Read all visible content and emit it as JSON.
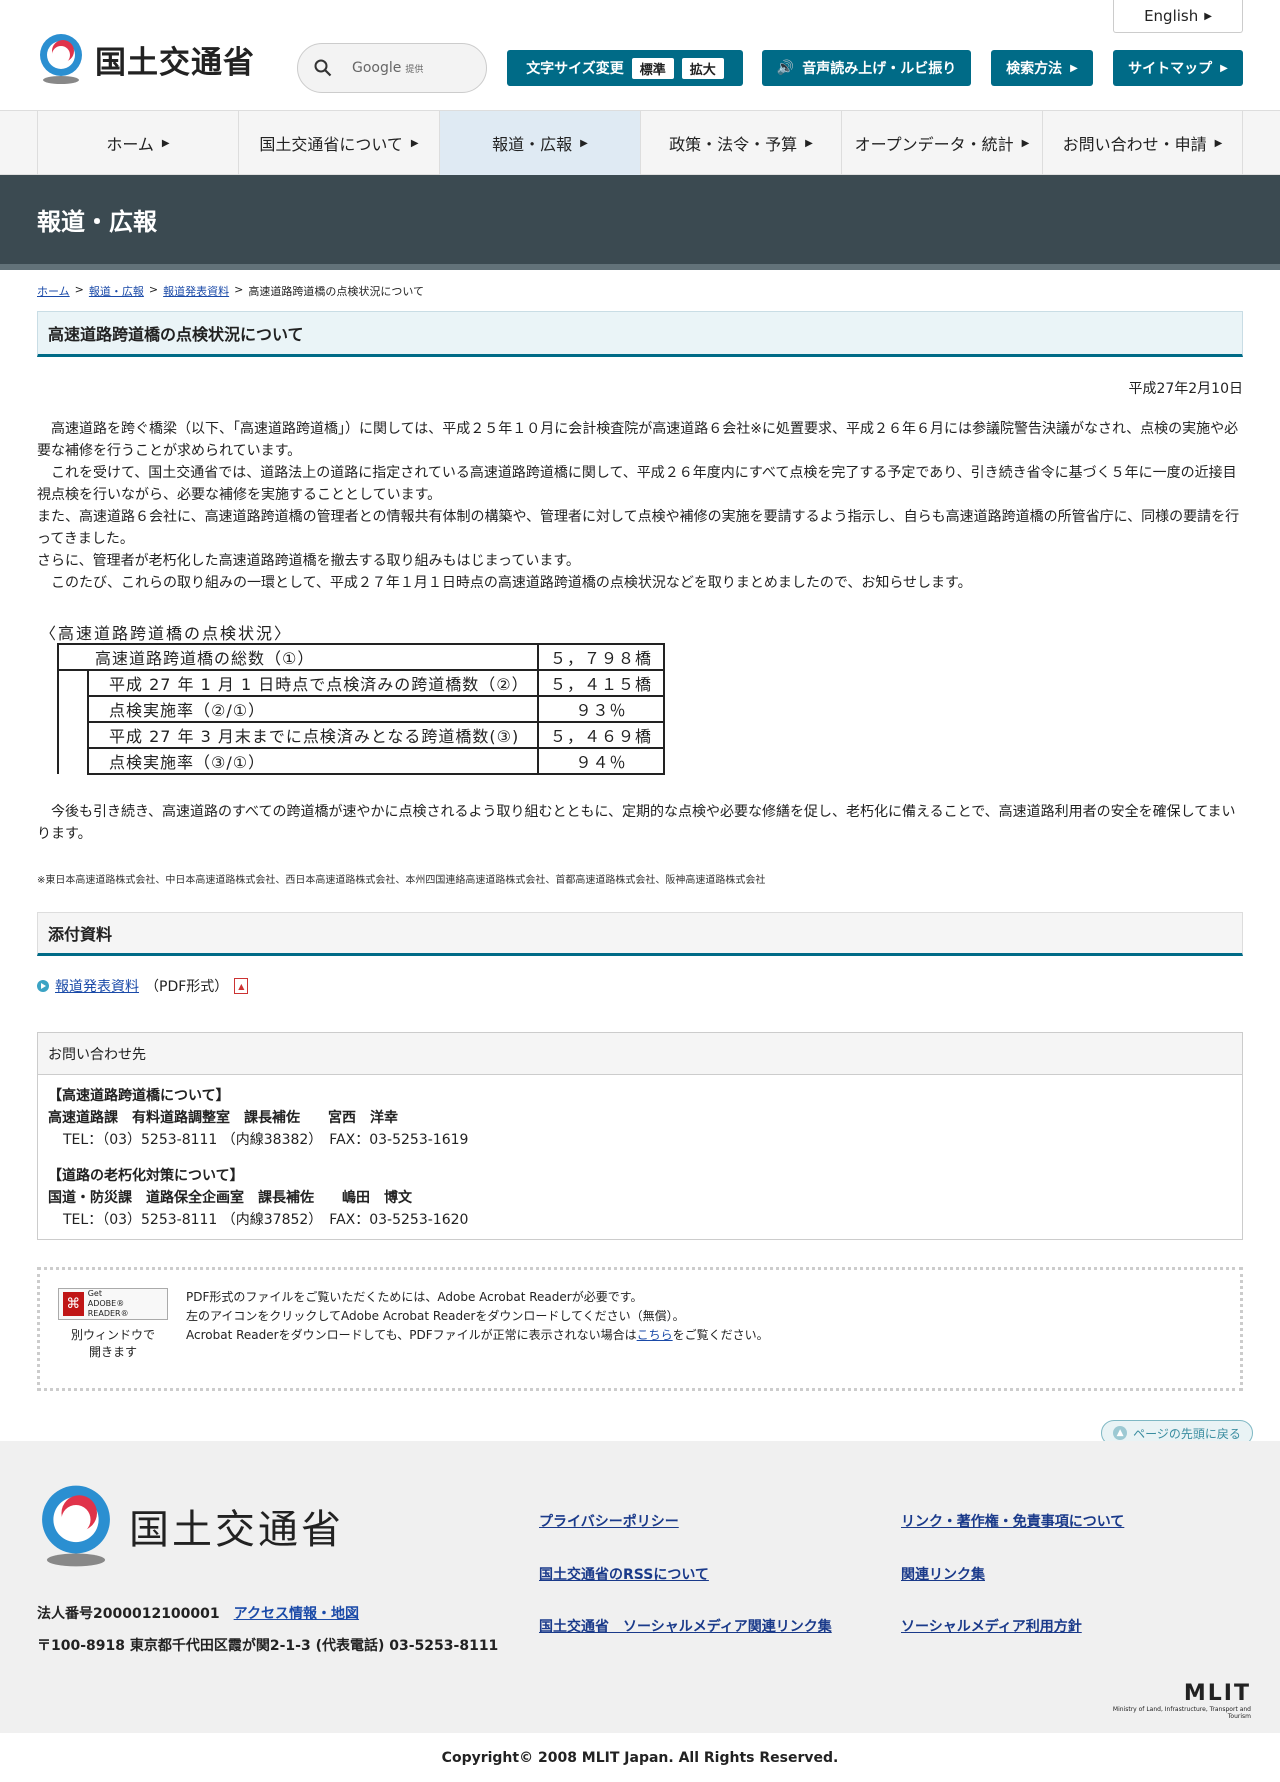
{
  "header": {
    "logo_text": "国土交通省",
    "search_placeholder": "Google",
    "search_suffix": "提供",
    "english": "English",
    "font_size_label": "文字サイズ変更",
    "font_standard": "標準",
    "font_large": "拡大",
    "speech": "音声読み上げ・ルビ振り",
    "search_method": "検索方法",
    "sitemap": "サイトマップ"
  },
  "nav": [
    "ホーム",
    "国土交通省について",
    "報道・広報",
    "政策・法令・予算",
    "オープンデータ・統計",
    "お問い合わせ・申請"
  ],
  "banner_title": "報道・広報",
  "breadcrumb": {
    "home": "ホーム",
    "press": "報道・広報",
    "releases": "報道発表資料",
    "current": "高速道路跨道橋の点検状況について",
    "sep": ">"
  },
  "article": {
    "title": "高速道路跨道橋の点検状況について",
    "date": "平成27年2月10日",
    "paragraphs": [
      "　高速道路を跨ぐ橋梁（以下、「高速道路跨道橋」）に関しては、平成２５年１０月に会計検査院が高速道路６会社※に処置要求、平成２６年６月には参議院警告決議がなされ、点検の実施や必要な補修を行うことが求められています。",
      "　これを受けて、国土交通省では、道路法上の道路に指定されている高速道路跨道橋に関して、平成２６年度内にすべて点検を完了する予定であり、引き続き省令に基づく５年に一度の近接目視点検を行いながら、必要な補修を実施することとしています。",
      "また、高速道路６会社に、高速道路跨道橋の管理者との情報共有体制の構築や、管理者に対して点検や補修の実施を要請するよう指示し、自らも高速道路跨道橋の所管省庁に、同様の要請を行ってきました。",
      "さらに、管理者が老朽化した高速道路跨道橋を撤去する取り組みもはじまっています。",
      "　このたび、これらの取り組みの一環として、平成２７年１月１日時点の高速道路跨道橋の点検状況などを取りまとめましたので、お知らせします。"
    ],
    "table_title": "〈高速道路跨道橋の点検状況〉",
    "table_rows": [
      {
        "label": "高速道路跨道橋の総数（①）",
        "value": "５，７９８橋"
      },
      {
        "label": "平成 27 年 1 月 1 日時点で点検済みの跨道橋数（②）",
        "value": "５，４１５橋"
      },
      {
        "label": "点検実施率（②/①）",
        "value": "９３％"
      },
      {
        "label": "平成 27 年 3 月末までに点検済みとなる跨道橋数(③)",
        "value": "５，４６９橋"
      },
      {
        "label": "点検実施率（③/①）",
        "value": "９４％"
      }
    ],
    "closing": "　今後も引き続き、高速道路のすべての跨道橋が速やかに点検されるよう取り組むとともに、定期的な点検や必要な修繕を促し、老朽化に備えることで、高速道路利用者の安全を確保してまいります。",
    "note": "※東日本高速道路株式会社、中日本高速道路株式会社、西日本高速道路株式会社、本州四国連絡高速道路株式会社、首都高速道路株式会社、阪神高速道路株式会社"
  },
  "attachments": {
    "title": "添付資料",
    "link": "報道発表資料",
    "format": "（PDF形式）"
  },
  "contact": {
    "title": "お問い合わせ先",
    "sections": [
      {
        "heading": "【高速道路跨道橋について】",
        "dept": "高速道路課　有料道路調整室　課長補佐　　宮西　洋幸",
        "tel": "TEL：（03）5253-8111 （内線38382）　FAX：03-5253-1619"
      },
      {
        "heading": "【道路の老朽化対策について】",
        "dept": "国道・防災課　道路保全企画室　課長補佐　　嶋田　博文",
        "tel": "TEL：（03）5253-8111 （内線37852）　FAX：03-5253-1620"
      }
    ]
  },
  "acrobat": {
    "badge_get": "Get",
    "badge_name": "ADOBE® READER®",
    "window_note_1": "別ウィンドウで",
    "window_note_2": "開きます",
    "line1": "PDF形式のファイルをご覧いただくためには、Adobe Acrobat Readerが必要です。",
    "line2": "左のアイコンをクリックしてAdobe Acrobat Readerをダウンロードしてください（無償）。",
    "line3_pre": "Acrobat Readerをダウンロードしても、PDFファイルが正常に表示されない場合は",
    "line3_link": "こちら",
    "line3_post": "をご覧ください。"
  },
  "page_top": "ページの先頭に戻る",
  "footer": {
    "logo_text": "国土交通省",
    "corp_number": "法人番号2000012100001",
    "access": "アクセス情報・地図",
    "address": "〒100-8918 東京都千代田区霞が関2-1-3 (代表電話) 03-5253-8111",
    "links": [
      "プライバシーポリシー",
      "リンク・著作権・免責事項について",
      "国土交通省のRSSについて",
      "関連リンク集",
      "国土交通省　ソーシャルメディア関連リンク集",
      "ソーシャルメディア利用方針"
    ],
    "mlit": "MLIT",
    "mlit_full": "Ministry of Land, Infrastructure, Transport and Tourism",
    "copyright": "Copyright© 2008 MLIT Japan. All Rights Reserved."
  },
  "colors": {
    "accent": "#006b87",
    "banner": "#3b4a51"
  }
}
